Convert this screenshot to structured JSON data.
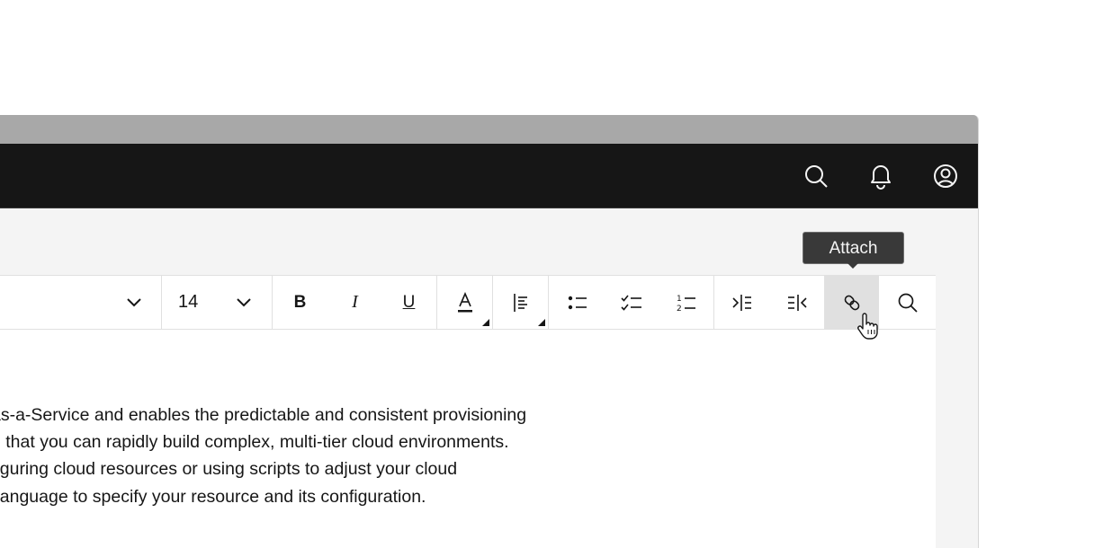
{
  "header": {
    "icons": [
      "search-icon",
      "notification-bell-icon",
      "user-avatar-icon"
    ]
  },
  "toolbar": {
    "font_size": "14",
    "buttons": [
      "chevron-down-icon",
      "bold-icon",
      "italic-icon",
      "underline-icon",
      "text-color-icon",
      "text-align-icon",
      "bullet-list-icon",
      "checklist-icon",
      "numbered-list-icon",
      "indent-icon",
      "outdent-icon",
      "link-icon",
      "search-icon"
    ],
    "active_button": "link-icon"
  },
  "tooltip": {
    "label": "Attach"
  },
  "editor": {
    "lines": [
      "as-a-Service and enables the predictable and consistent provisioning",
      "o that you can rapidly build complex, multi-tier cloud environments.",
      "figuring cloud resources or using scripts to adjust your cloud",
      " language to specify your resource and its configuration."
    ]
  },
  "colors": {
    "header_bg": "#161616",
    "titlebar_bg": "#a8a8a8",
    "workspace_bg": "#f4f4f4",
    "active_btn_bg": "#e0e0e0",
    "tooltip_bg": "#393939"
  }
}
